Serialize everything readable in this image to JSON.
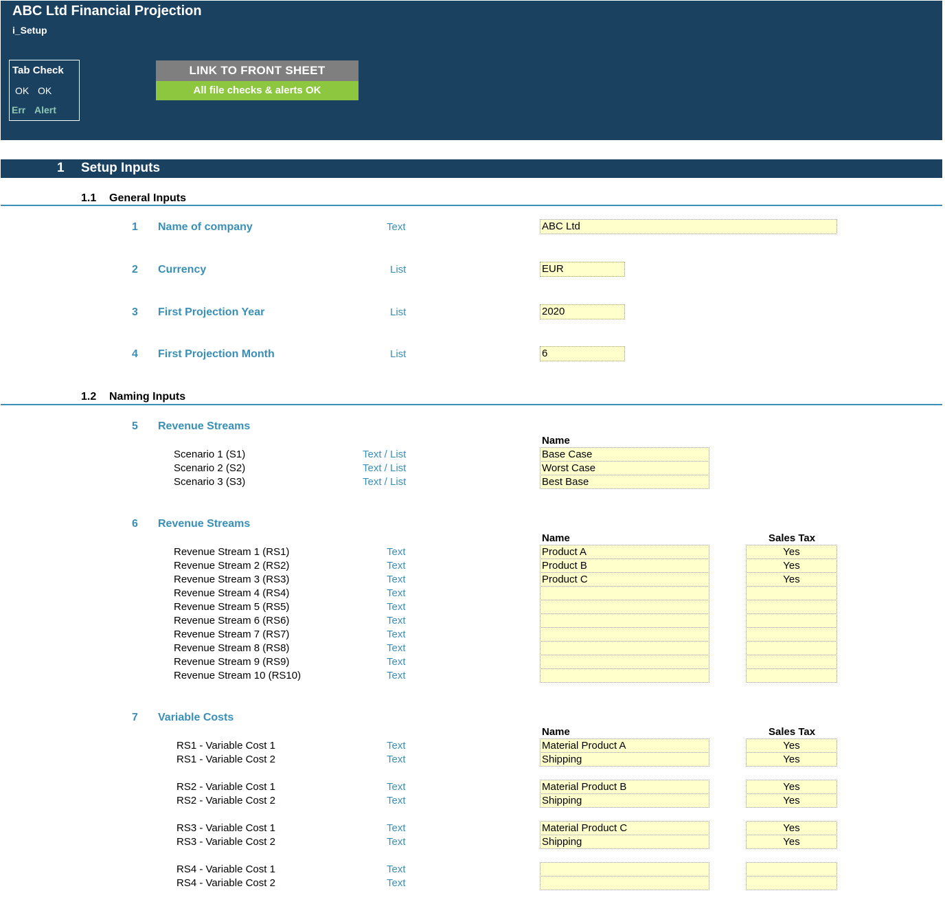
{
  "header": {
    "title": "ABC Ltd Financial Projection",
    "sheet": "i_Setup",
    "tab_check": {
      "title": "Tab Check",
      "ok1": "OK",
      "ok2": "OK",
      "err": "Err",
      "alert": "Alert"
    },
    "link_button": "LINK TO FRONT SHEET",
    "status": "All file checks & alerts OK"
  },
  "section": {
    "number": "1",
    "title": "Setup Inputs"
  },
  "general": {
    "number": "1.1",
    "title": "General Inputs",
    "items": [
      {
        "num": "1",
        "label": "Name of company",
        "type": "Text",
        "value": "ABC Ltd"
      },
      {
        "num": "2",
        "label": "Currency",
        "type": "List",
        "value": "EUR"
      },
      {
        "num": "3",
        "label": "First Projection Year",
        "type": "List",
        "value": "2020"
      },
      {
        "num": "4",
        "label": "First Projection Month",
        "type": "List",
        "value": "6"
      }
    ]
  },
  "naming": {
    "number": "1.2",
    "title": "Naming Inputs",
    "scenarios": {
      "num": "5",
      "label": "Revenue Streams",
      "name_header": "Name",
      "rows": [
        {
          "label": "Scenario 1 (S1)",
          "type": "Text / List",
          "name": "Base Case"
        },
        {
          "label": "Scenario 2 (S2)",
          "type": "Text / List",
          "name": "Worst Case"
        },
        {
          "label": "Scenario 3 (S3)",
          "type": "Text / List",
          "name": "Best Base"
        }
      ]
    },
    "revenue_streams": {
      "num": "6",
      "label": "Revenue Streams",
      "name_header": "Name",
      "tax_header": "Sales Tax",
      "rows": [
        {
          "label": "Revenue Stream 1 (RS1)",
          "type": "Text",
          "name": "Product A",
          "tax": "Yes"
        },
        {
          "label": "Revenue Stream 2 (RS2)",
          "type": "Text",
          "name": "Product B",
          "tax": "Yes"
        },
        {
          "label": "Revenue Stream 3 (RS3)",
          "type": "Text",
          "name": "Product C",
          "tax": "Yes"
        },
        {
          "label": "Revenue Stream 4 (RS4)",
          "type": "Text",
          "name": "",
          "tax": ""
        },
        {
          "label": "Revenue Stream 5 (RS5)",
          "type": "Text",
          "name": "",
          "tax": ""
        },
        {
          "label": "Revenue Stream 6 (RS6)",
          "type": "Text",
          "name": "",
          "tax": ""
        },
        {
          "label": "Revenue Stream 7 (RS7)",
          "type": "Text",
          "name": "",
          "tax": ""
        },
        {
          "label": "Revenue Stream 8 (RS8)",
          "type": "Text",
          "name": "",
          "tax": ""
        },
        {
          "label": "Revenue Stream 9 (RS9)",
          "type": "Text",
          "name": "",
          "tax": ""
        },
        {
          "label": "Revenue Stream 10 (RS10)",
          "type": "Text",
          "name": "",
          "tax": ""
        }
      ]
    },
    "variable_costs": {
      "num": "7",
      "label": "Variable Costs",
      "name_header": "Name",
      "tax_header": "Sales Tax",
      "rows": [
        {
          "label": "RS1 - Variable Cost 1",
          "type": "Text",
          "name": "Material Product A",
          "tax": "Yes"
        },
        {
          "label": "RS1 - Variable Cost 2",
          "type": "Text",
          "name": "Shipping",
          "tax": "Yes"
        },
        {
          "label": "RS2 - Variable Cost 1",
          "type": "Text",
          "name": "Material Product B",
          "tax": "Yes"
        },
        {
          "label": "RS2 - Variable Cost 2",
          "type": "Text",
          "name": "Shipping",
          "tax": "Yes"
        },
        {
          "label": "RS3 - Variable Cost 1",
          "type": "Text",
          "name": "Material Product C",
          "tax": "Yes"
        },
        {
          "label": "RS3 - Variable Cost 2",
          "type": "Text",
          "name": "Shipping",
          "tax": "Yes"
        },
        {
          "label": "RS4 - Variable Cost 1",
          "type": "Text",
          "name": "",
          "tax": ""
        },
        {
          "label": "RS4 - Variable Cost 2",
          "type": "Text",
          "name": "",
          "tax": ""
        }
      ]
    }
  }
}
